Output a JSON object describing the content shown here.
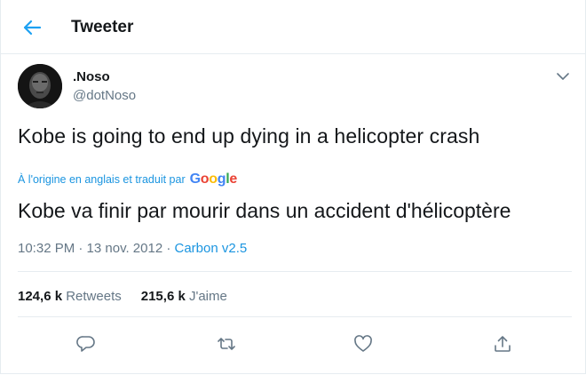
{
  "header": {
    "title": "Tweeter"
  },
  "author": {
    "name": ".Noso",
    "handle": "@dotNoso"
  },
  "tweet": {
    "text": "Kobe is going to end up dying in a helicopter crash",
    "translation_note": "À l'origine en anglais et traduit par",
    "translator": "Google",
    "translated_text": "Kobe va finir par mourir dans un accident d'hélicoptère",
    "timestamp": "10:32 PM · 13 nov. 2012 · ",
    "source": "Carbon v2.5"
  },
  "stats": {
    "retweets_count": "124,6 k",
    "retweets_label": "Retweets",
    "likes_count": "215,6 k",
    "likes_label": "J'aime"
  },
  "colors": {
    "accent": "#1da1f2",
    "link": "#1b95e0",
    "secondary_text": "#657786",
    "border": "#e6ecf0"
  },
  "icons": [
    "back-arrow-icon",
    "chevron-down-icon",
    "reply-icon",
    "retweet-icon",
    "like-icon",
    "share-icon"
  ]
}
